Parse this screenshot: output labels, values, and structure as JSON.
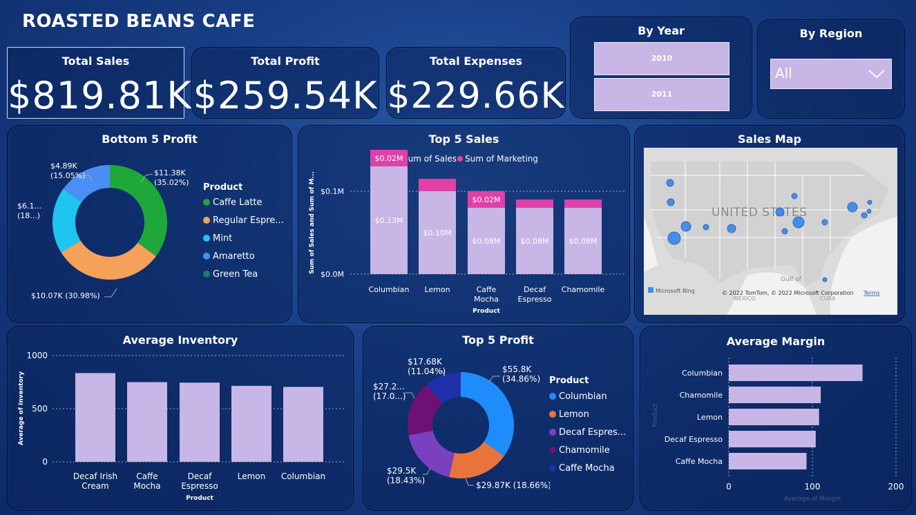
{
  "header": {
    "title": "ROASTED BEANS CAFE"
  },
  "kpis": {
    "sales": {
      "label": "Total Sales",
      "value": "$819.81K"
    },
    "profit": {
      "label": "Total Profit",
      "value": "$259.54K"
    },
    "expenses": {
      "label": "Total Expenses",
      "value": "$229.66K"
    }
  },
  "by_year": {
    "title": "By Year",
    "options": [
      "2010",
      "2011"
    ]
  },
  "by_region": {
    "title": "By Region",
    "selected": "All"
  },
  "colors": {
    "lavender": "#c7b6e6",
    "magenta": "#e040a8",
    "green": "#1fa83a",
    "orange": "#f5a15a",
    "cyan": "#1ec5ef",
    "blue": "#4b8ef5",
    "teal": "#1f7a6a",
    "p_blue": "#1e8dfb",
    "p_orange": "#e8743c",
    "p_purple": "#7b40c0",
    "p_plum": "#6e1175",
    "p_navy": "#1f2fa8"
  },
  "bottom5": {
    "title": "Bottom 5 Profit",
    "legend_title": "Product",
    "legend": [
      "Caffe Latte",
      "Regular Espre...",
      "Mint",
      "Amaretto",
      "Green Tea"
    ],
    "labels": {
      "caffe_latte": [
        "$11.38K",
        "(35.02%)"
      ],
      "regular_espresso": [
        "$10.07K (30.98%)"
      ],
      "mint": [
        "$6.1...",
        "(18...)"
      ],
      "amaretto": [
        "$4.89K",
        "(15.05%)"
      ]
    }
  },
  "top5sales": {
    "title": "Top 5 Sales",
    "legend": [
      "Sum of Sales",
      "Sum of Marketing"
    ],
    "y_ticks": [
      "$0.1M",
      "$0.0M"
    ],
    "ylabel": "Sum of Sales and Sum of M...",
    "xlabel": "Product",
    "categories": [
      "Columbian",
      "Lemon",
      "Caffe Mocha",
      "Decaf Espresso",
      "Chamomile"
    ],
    "sales_labels": [
      "$0.13M",
      "$0.10M",
      "$0.08M",
      "$0.08M",
      "$0.08M"
    ],
    "marketing_labels": [
      "$0.02M",
      "",
      "$0.02M",
      "",
      ""
    ]
  },
  "sales_map": {
    "title": "Sales Map",
    "country_label": "UNITED STATES",
    "gulf_label": "Gulf of Mexico",
    "mexico_label": "MÉXICO",
    "cuba_label": "CUBA",
    "attribution": "© 2022 TomTom, © 2022 Microsoft Corporation",
    "terms": "Terms",
    "bing": "Microsoft Bing"
  },
  "avg_inventory": {
    "title": "Average Inventory",
    "ylabel": "Average of Inventory",
    "xlabel": "Product",
    "y_ticks": [
      "1000",
      "500",
      "0"
    ],
    "categories": [
      "Decaf Irish Cream",
      "Caffe Mocha",
      "Decaf Espresso",
      "Lemon",
      "Columbian"
    ]
  },
  "top5profit": {
    "title": "Top 5 Profit",
    "legend_title": "Product",
    "legend": [
      "Columbian",
      "Lemon",
      "Decaf Espres...",
      "Chamomile",
      "Caffe Mocha"
    ],
    "labels": {
      "columbian": [
        "$55.8K",
        "(34.86%)"
      ],
      "lemon": [
        "$29.87K (18.66%)"
      ],
      "decaf": [
        "$29.5K",
        "(18.43%)"
      ],
      "chamomile": [
        "$27.2...",
        "(17.0...)"
      ],
      "mocha": [
        "$17.68K",
        "(11.04%)"
      ]
    }
  },
  "avg_margin": {
    "title": "Average Margin",
    "ylabel": "Product",
    "xlabel": "Average of Margin",
    "x_ticks": [
      "0",
      "100",
      "200"
    ],
    "categories": [
      "Columbian",
      "Chamomile",
      "Lemon",
      "Decaf Espresso",
      "Caffe Mocha"
    ]
  },
  "chart_data": [
    {
      "type": "pie",
      "title": "Bottom 5 Profit",
      "categories": [
        "Caffe Latte",
        "Regular Espresso",
        "Mint",
        "Amaretto",
        "Green Tea"
      ],
      "values": [
        11.38,
        10.07,
        6.1,
        4.89,
        0.0
      ],
      "percents": [
        35.02,
        30.98,
        18.0,
        15.05,
        0.0
      ]
    },
    {
      "type": "bar",
      "title": "Top 5 Sales",
      "categories": [
        "Columbian",
        "Lemon",
        "Caffe Mocha",
        "Decaf Espresso",
        "Chamomile"
      ],
      "series": [
        {
          "name": "Sum of Sales",
          "values": [
            0.13,
            0.1,
            0.08,
            0.08,
            0.08
          ]
        },
        {
          "name": "Sum of Marketing",
          "values": [
            0.02,
            0.015,
            0.02,
            0.01,
            0.01
          ]
        }
      ],
      "ylim": [
        0,
        0.15
      ]
    },
    {
      "type": "bar",
      "title": "Average Inventory",
      "categories": [
        "Decaf Irish Cream",
        "Caffe Mocha",
        "Decaf Espresso",
        "Lemon",
        "Columbian"
      ],
      "values": [
        835,
        750,
        745,
        715,
        705
      ],
      "ylim": [
        0,
        1000
      ]
    },
    {
      "type": "pie",
      "title": "Top 5 Profit",
      "categories": [
        "Columbian",
        "Lemon",
        "Decaf Espresso",
        "Chamomile",
        "Caffe Mocha"
      ],
      "values": [
        55.8,
        29.87,
        29.5,
        27.2,
        17.68
      ],
      "percents": [
        34.86,
        18.66,
        18.43,
        17.0,
        11.04
      ]
    },
    {
      "type": "bar",
      "title": "Average Margin",
      "categories": [
        "Columbian",
        "Chamomile",
        "Lemon",
        "Decaf Espresso",
        "Caffe Mocha"
      ],
      "values": [
        160,
        110,
        108,
        104,
        93
      ],
      "xlim": [
        0,
        200
      ]
    }
  ]
}
